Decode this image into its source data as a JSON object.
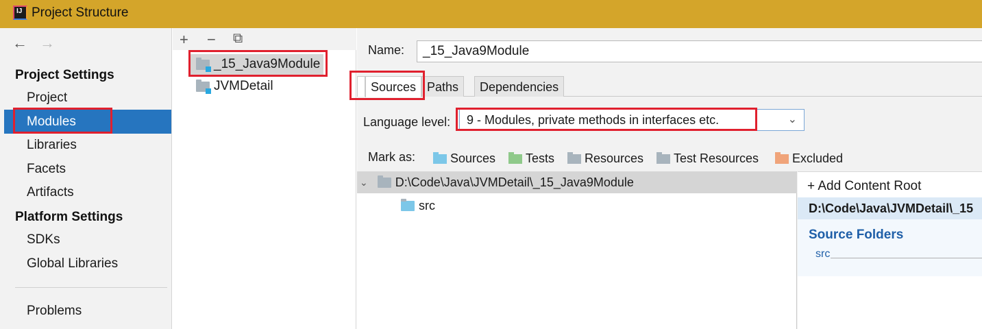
{
  "window": {
    "title": "Project Structure",
    "app_icon_text": "IJ"
  },
  "nav": {
    "back_icon": "←",
    "forward_icon": "→"
  },
  "sidebar": {
    "project_settings_header": "Project Settings",
    "project_items": [
      {
        "label": "Project"
      },
      {
        "label": "Modules",
        "selected": true
      },
      {
        "label": "Libraries"
      },
      {
        "label": "Facets"
      },
      {
        "label": "Artifacts"
      }
    ],
    "platform_settings_header": "Platform Settings",
    "platform_items": [
      {
        "label": "SDKs"
      },
      {
        "label": "Global Libraries"
      }
    ],
    "problems_label": "Problems"
  },
  "module_list": {
    "toolbar": {
      "add_icon": "+",
      "remove_icon": "−",
      "copy_icon": "⧉"
    },
    "modules": [
      {
        "name": "_15_Java9Module",
        "selected": true
      },
      {
        "name": "JVMDetail"
      }
    ]
  },
  "module_settings": {
    "name_label": "Name:",
    "name_value": "_15_Java9Module",
    "tabs": [
      {
        "label": "Sources",
        "active": true
      },
      {
        "label": "Paths"
      },
      {
        "label": "Dependencies"
      }
    ],
    "language_level_label": "Language level:",
    "language_level_value": "9 - Modules, private methods in interfaces etc.",
    "mark_as_label": "Mark as:",
    "mark_as_options": [
      {
        "label": "Sources",
        "color": "#7cc7e8"
      },
      {
        "label": "Tests",
        "color": "#8fc98a"
      },
      {
        "label": "Resources",
        "color": "#a8b4bd"
      },
      {
        "label": "Test Resources",
        "color": "#a8b4bd"
      },
      {
        "label": "Excluded",
        "color": "#f0a47a"
      }
    ]
  },
  "source_tree": {
    "root_path": "D:\\Code\\Java\\JVMDetail\\_15_Java9Module",
    "children": [
      {
        "name": "src"
      }
    ]
  },
  "content_roots": {
    "add_label": "Add Content Root",
    "root_path": "D:\\Code\\Java\\JVMDetail\\_15",
    "source_folders_header": "Source Folders",
    "source_folders": [
      "src"
    ]
  },
  "colors": {
    "title_bar": "#d4a52a",
    "selection": "#2675bf",
    "annotation": "#e0202e",
    "link_blue": "#1f5fa8"
  }
}
